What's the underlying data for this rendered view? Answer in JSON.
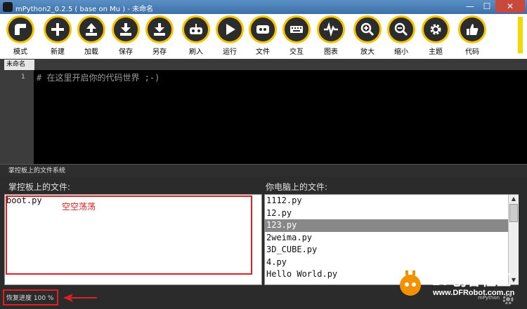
{
  "window": {
    "title": "mPython2_0.2.5 ( base on Mu ) - 未命名",
    "min": "—",
    "max": "☐",
    "close": "✕"
  },
  "toolbar": [
    {
      "id": "mode",
      "label": "模式",
      "icon": "mode-icon"
    },
    {
      "id": "new",
      "label": "新建",
      "icon": "plus-icon"
    },
    {
      "id": "load",
      "label": "加载",
      "icon": "upload-icon"
    },
    {
      "id": "save",
      "label": "保存",
      "icon": "download-icon"
    },
    {
      "id": "saveas",
      "label": "另存",
      "icon": "download-icon"
    },
    {
      "id": "flash",
      "label": "刷入",
      "icon": "robot-icon"
    },
    {
      "id": "run",
      "label": "运行",
      "icon": "play-icon"
    },
    {
      "id": "files",
      "label": "文件",
      "icon": "files-icon"
    },
    {
      "id": "repl",
      "label": "交互",
      "icon": "keyboard-icon"
    },
    {
      "id": "plot",
      "label": "图表",
      "icon": "wave-icon"
    },
    {
      "id": "zoomin",
      "label": "放大",
      "icon": "zoom-in-icon"
    },
    {
      "id": "zoomout",
      "label": "缩小",
      "icon": "zoom-out-icon"
    },
    {
      "id": "theme",
      "label": "主题",
      "icon": "gear-icon"
    },
    {
      "id": "code",
      "label": "代码",
      "icon": "thumbs-up-icon"
    }
  ],
  "tab": {
    "label": "未命名"
  },
  "editor": {
    "line_number": "1",
    "code": "# 在这里开启你的代码世界 ;-)"
  },
  "filesystem": {
    "header": "掌控板上的文件系统",
    "device_label": "掌控板上的文件:",
    "computer_label": "你电脑上的文件:",
    "device_files": [
      "boot.py"
    ],
    "annotation": "空空荡荡",
    "computer_files": [
      "1112.py",
      "12.py",
      "123.py",
      "2weima.py",
      "3D_CUBE.py",
      "4.py",
      "Hello World.py"
    ],
    "selected_index": 2
  },
  "status": {
    "text": "恢复进度 100 %"
  },
  "watermark": {
    "line1": "DF创客社区",
    "line2": "www.DFRobot.com.cn",
    "small": "mPython"
  },
  "colors": {
    "accent": "#f5c400",
    "annotation_red": "#e02020"
  }
}
